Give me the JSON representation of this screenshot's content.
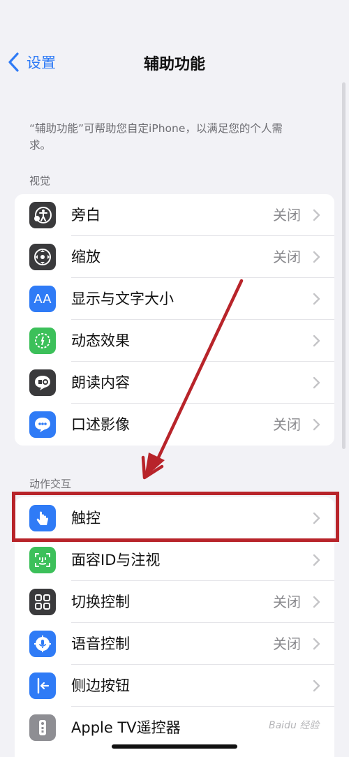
{
  "nav": {
    "back_label": "设置",
    "title": "辅助功能"
  },
  "intro": "“辅助功能”可帮助您自定iPhone，以满足您的个人需求。",
  "sections": [
    {
      "header": "视觉",
      "items": [
        {
          "label": "旁白",
          "value": "关闭",
          "icon": "voiceover-icon"
        },
        {
          "label": "缩放",
          "value": "关闭",
          "icon": "zoom-icon"
        },
        {
          "label": "显示与文字大小",
          "value": "",
          "icon": "text-size-icon",
          "icon_text": "AA"
        },
        {
          "label": "动态效果",
          "value": "",
          "icon": "motion-icon"
        },
        {
          "label": "朗读内容",
          "value": "",
          "icon": "spoken-content-icon"
        },
        {
          "label": "口述影像",
          "value": "关闭",
          "icon": "audio-description-icon"
        }
      ]
    },
    {
      "header": "动作交互",
      "items": [
        {
          "label": "触控",
          "value": "",
          "icon": "touch-icon"
        },
        {
          "label": "面容ID与注视",
          "value": "",
          "icon": "face-id-icon"
        },
        {
          "label": "切换控制",
          "value": "关闭",
          "icon": "switch-control-icon"
        },
        {
          "label": "语音控制",
          "value": "关闭",
          "icon": "voice-control-icon"
        },
        {
          "label": "侧边按钮",
          "value": "",
          "icon": "side-button-icon"
        },
        {
          "label": "Apple TV遥控器",
          "value": "",
          "icon": "tv-remote-icon"
        }
      ]
    }
  ],
  "watermark": "Baidu 经验",
  "colors": {
    "accent": "#2f7bf6",
    "highlight_box": "#b8242a",
    "arrow": "#b8242a",
    "background": "#f2f2f6"
  }
}
